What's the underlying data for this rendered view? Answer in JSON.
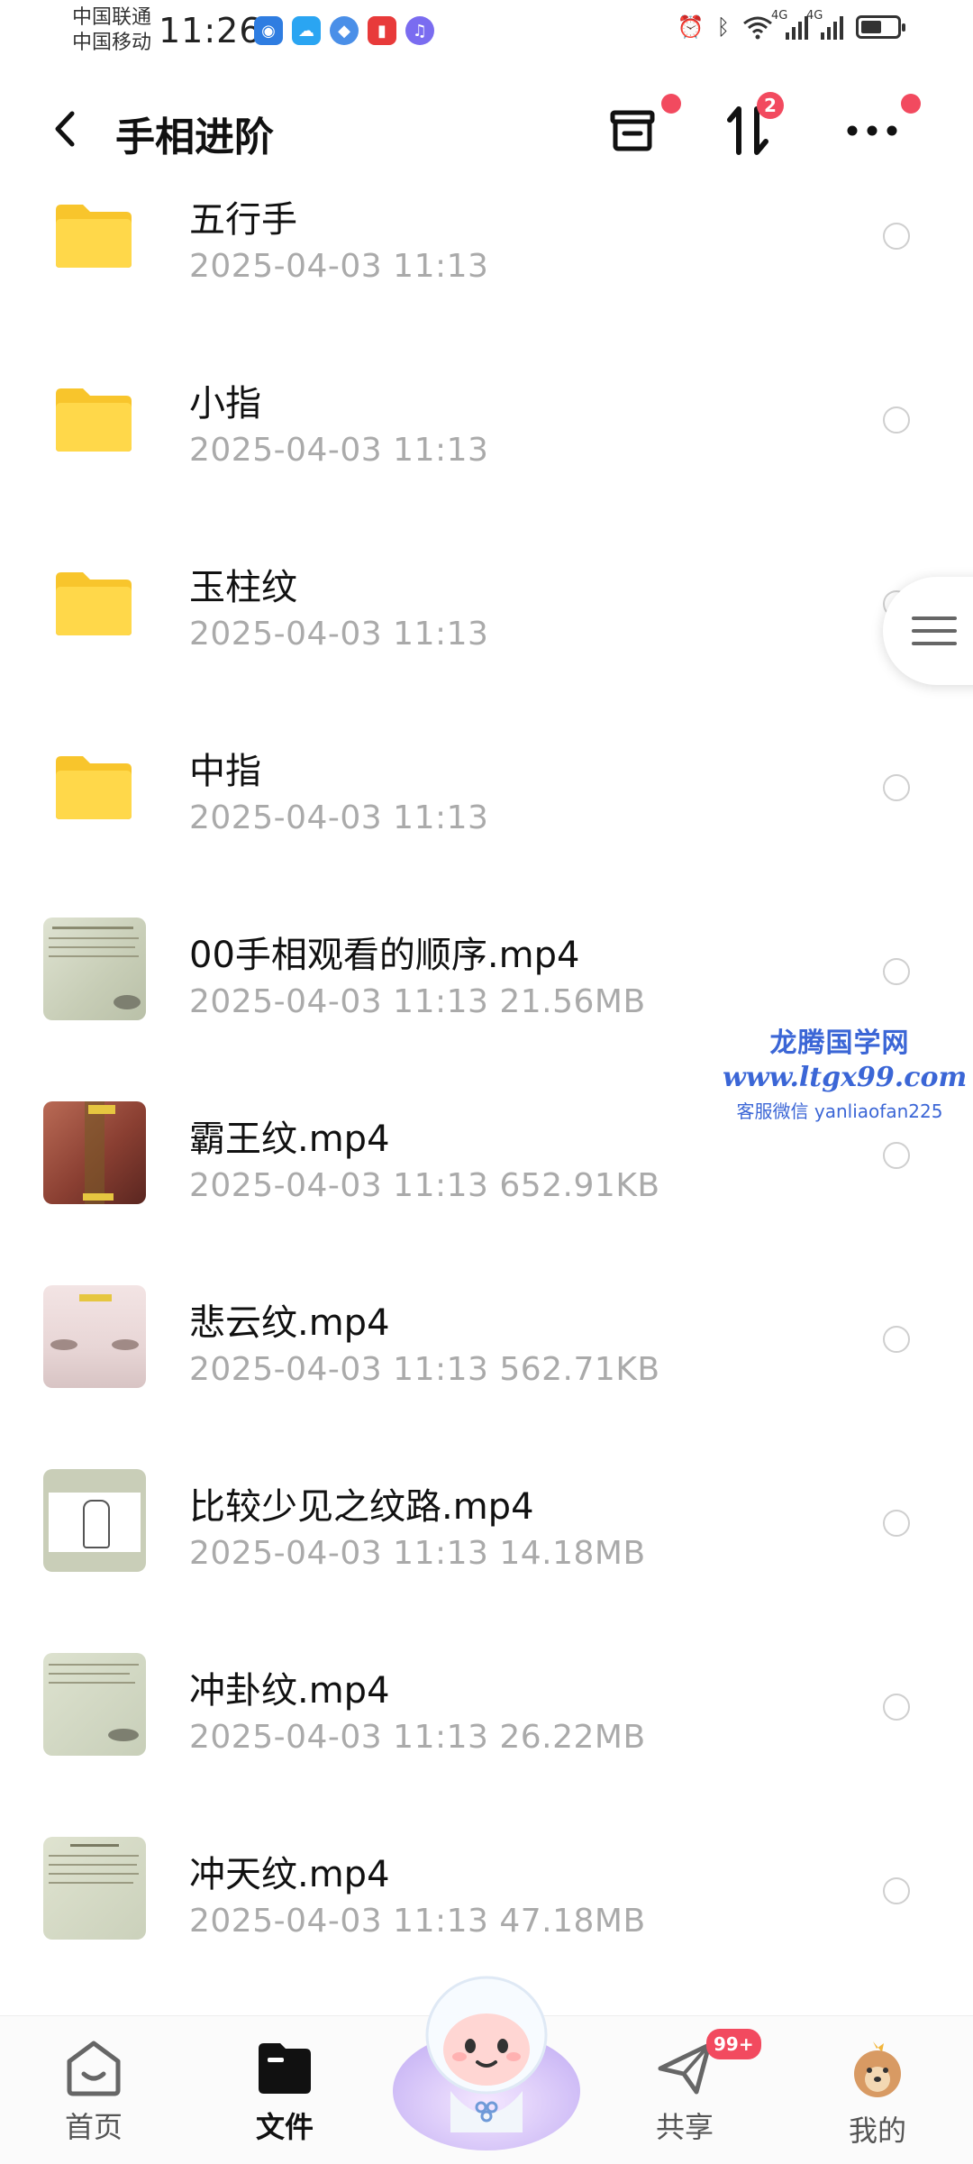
{
  "status_bar": {
    "carrier_1": "中国联通",
    "carrier_2": "中国移动",
    "time": "11:26",
    "net_1": "4G",
    "net_2": "4G"
  },
  "header": {
    "title": "手相进阶",
    "transfer_badge": "2"
  },
  "files": [
    {
      "name": "五行手",
      "meta": "2025-04-03  11:13",
      "kind": "folder"
    },
    {
      "name": "小指",
      "meta": "2025-04-03  11:13",
      "kind": "folder"
    },
    {
      "name": "玉柱纹",
      "meta": "2025-04-03  11:13",
      "kind": "folder"
    },
    {
      "name": "中指",
      "meta": "2025-04-03  11:13",
      "kind": "folder"
    },
    {
      "name": "00手相观看的顺序.mp4",
      "meta": "2025-04-03  11:13  21.56MB",
      "kind": "video"
    },
    {
      "name": "霸王纹.mp4",
      "meta": "2025-04-03  11:13  652.91KB",
      "kind": "video"
    },
    {
      "name": "悲云纹.mp4",
      "meta": "2025-04-03  11:13  562.71KB",
      "kind": "video"
    },
    {
      "name": "比较少见之纹路.mp4",
      "meta": "2025-04-03  11:13  14.18MB",
      "kind": "video"
    },
    {
      "name": "冲卦纹.mp4",
      "meta": "2025-04-03  11:13  26.22MB",
      "kind": "video"
    },
    {
      "name": "冲天纹.mp4",
      "meta": "2025-04-03  11:13  47.18MB",
      "kind": "video"
    }
  ],
  "watermark": {
    "line1": "龙腾国学网",
    "line2": "www.ltgx99.com",
    "line3": "客服微信 yanliaofan225"
  },
  "bottom_nav": {
    "home": "首页",
    "files": "文件",
    "share": "共享",
    "share_badge": "99+",
    "mine": "我的"
  },
  "colors": {
    "accent_red": "#f24a5f",
    "folder_yellow": "#ffd43b",
    "watermark_blue": "#3b66d6"
  }
}
